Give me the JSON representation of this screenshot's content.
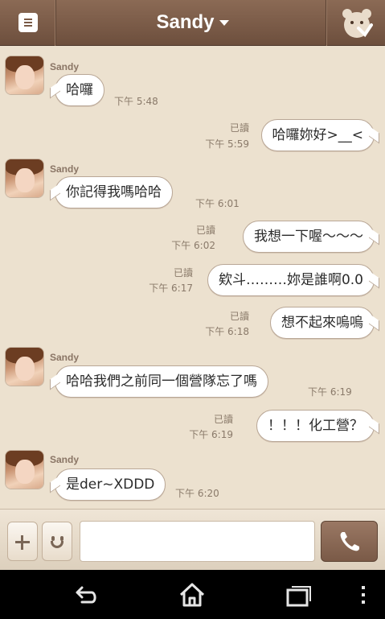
{
  "header": {
    "title": "Sandy",
    "menu_icon": "menu-icon",
    "right_icon": "bear-heart-icon"
  },
  "messages": [
    {
      "dir": "in",
      "sender": "Sandy",
      "text": "哈囉",
      "time": "下午 5:48"
    },
    {
      "dir": "out",
      "status": "已讀",
      "text": "哈囉妳好>__<",
      "time": "下午 5:59"
    },
    {
      "dir": "in",
      "sender": "Sandy",
      "text": "你記得我嗎哈哈",
      "time": "下午 6:01"
    },
    {
      "dir": "out",
      "status": "已讀",
      "text": "我想一下喔～～～",
      "time": "下午 6:02"
    },
    {
      "dir": "out",
      "status": "已讀",
      "text": "欸斗………妳是誰啊0.0",
      "time": "下午 6:17"
    },
    {
      "dir": "out",
      "status": "已讀",
      "text": "想不起來嗚嗚",
      "time": "下午 6:18"
    },
    {
      "dir": "in",
      "sender": "Sandy",
      "text": "哈哈我們之前同一個營隊忘了嗎",
      "time": "下午 6:19"
    },
    {
      "dir": "out",
      "status": "已讀",
      "text": "！！！化工營？",
      "time": "下午 6:19"
    },
    {
      "dir": "in",
      "sender": "Sandy",
      "text": "是der~XDDD",
      "time": "下午 6:20"
    }
  ],
  "input": {
    "value": "",
    "placeholder": ""
  },
  "icons": {
    "plus": "plus-icon",
    "emoticon": "smiley-icon",
    "call": "phone-icon",
    "back": "back-icon",
    "home": "home-icon",
    "recents": "recent-apps-icon",
    "more": "more-vert-icon"
  },
  "colors": {
    "header": "#7a5a47",
    "background": "#ece1cf",
    "bubble": "#ffffff"
  }
}
